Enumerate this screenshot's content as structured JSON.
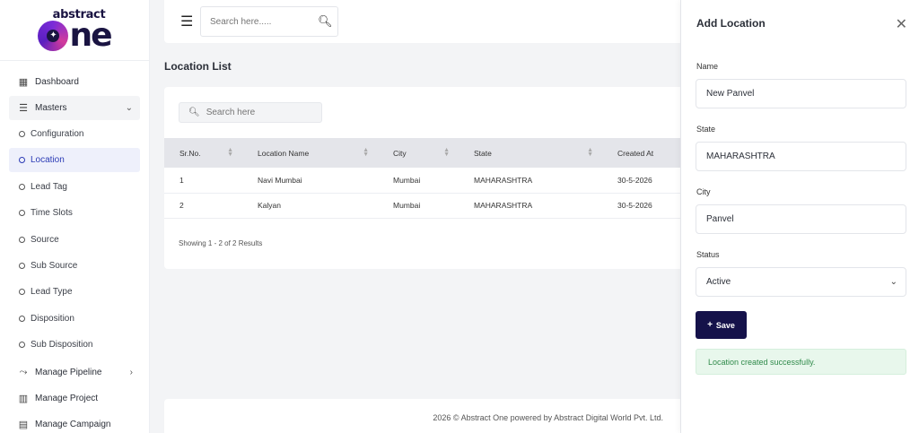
{
  "logo": {
    "top": "abstract",
    "main": "ne"
  },
  "sidebar": {
    "dashboard": "Dashboard",
    "masters": "Masters",
    "sub_items": [
      "Configuration",
      "Location",
      "Lead Tag",
      "Time Slots",
      "Source",
      "Sub Source",
      "Lead Type",
      "Disposition",
      "Sub Disposition"
    ],
    "manage_pipeline": "Manage Pipeline",
    "manage_project": "Manage Project",
    "cut_item": "Manage Campaign"
  },
  "topbar": {
    "search_placeholder": "Search here....."
  },
  "page": {
    "title": "Location List"
  },
  "list": {
    "search_placeholder": "Search here",
    "columns": [
      "Sr.No.",
      "Location Name",
      "City",
      "State",
      "Created At"
    ],
    "rows": [
      [
        "1",
        "Navi Mumbai",
        "Mumbai",
        "MAHARASHTRA",
        "30-5-2026"
      ],
      [
        "2",
        "Kalyan",
        "Mumbai",
        "MAHARASHTRA",
        "30-5-2026"
      ]
    ],
    "results": "Showing 1 - 2 of 2 Results"
  },
  "footer": {
    "text": "2026 © Abstract One powered by Abstract Digital World Pvt. Ltd."
  },
  "panel": {
    "title": "Add Location",
    "name_label": "Name",
    "name_value": "New Panvel",
    "state_label": "State",
    "state_value": "MAHARASHTRA",
    "city_label": "City",
    "city_value": "Panvel",
    "status_label": "Status",
    "status_value": "Active",
    "save_label": "Save",
    "alert": "Location created successfully."
  },
  "colors": {
    "brand": "#15124a",
    "active_nav": "#eef0fb",
    "success_bg": "#e8f7ec",
    "success_text": "#2f8a4a"
  },
  "icons": [
    "dashboard-icon",
    "list-icon",
    "chevron-down-icon",
    "pipeline-icon",
    "building-icon",
    "menu-icon",
    "search-icon",
    "close-icon"
  ]
}
